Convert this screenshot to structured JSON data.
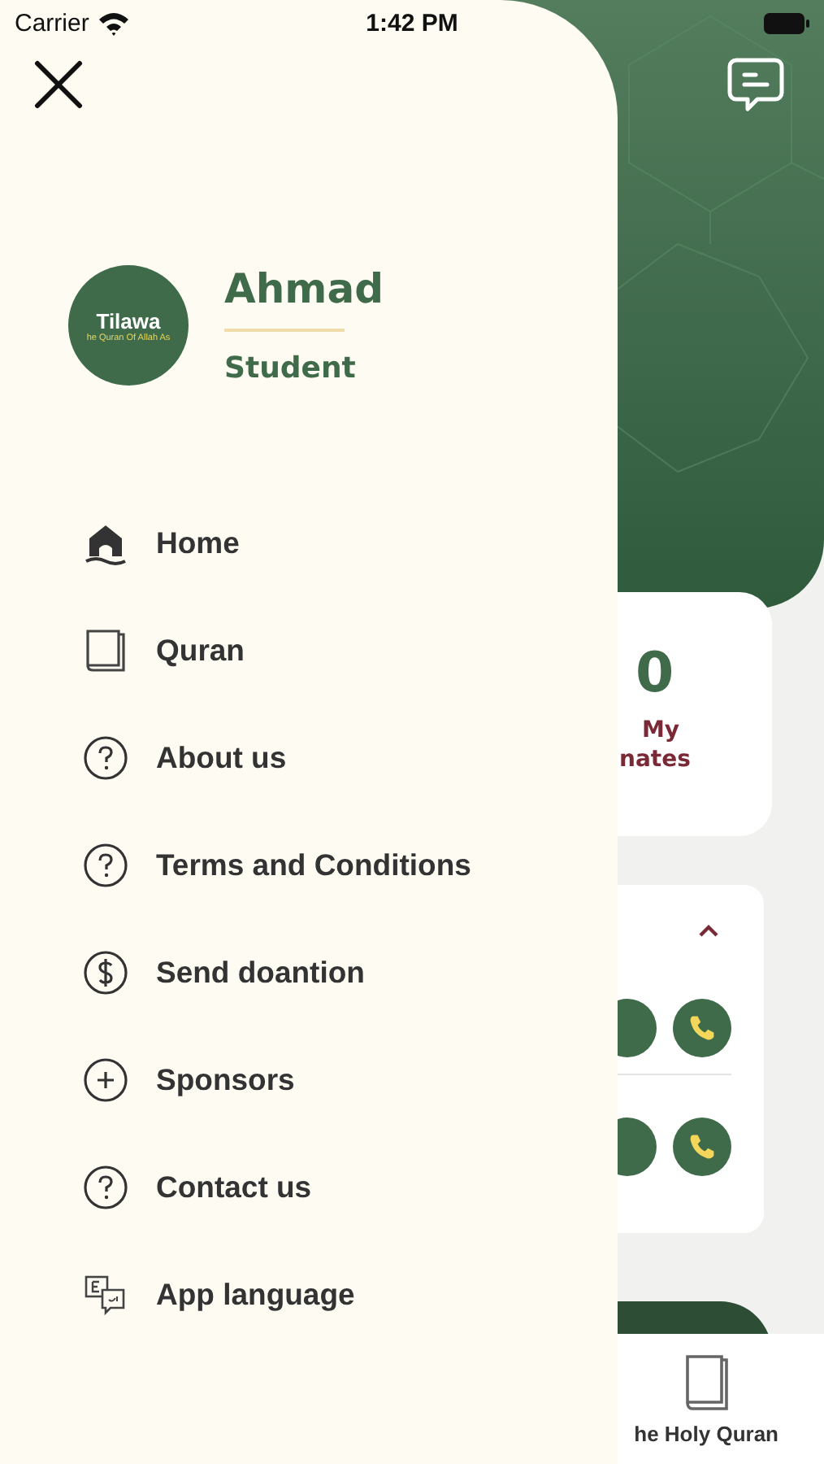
{
  "status_bar": {
    "carrier": "Carrier",
    "time": "1:42 PM"
  },
  "background": {
    "stat_card": {
      "value": "0",
      "label_lines": [
        "My",
        "nates"
      ]
    },
    "contacts_card": {
      "expanded": true
    },
    "tab_bar": {
      "label": "he Holy Quran"
    }
  },
  "drawer": {
    "profile": {
      "logo_title": "Tilawa",
      "logo_subtitle": "he Quran Of Allah As",
      "name": "Ahmad",
      "role": "Student"
    },
    "menu": [
      {
        "label": "Home",
        "kind": "home"
      },
      {
        "label": "Quran",
        "kind": "book"
      },
      {
        "label": "About us",
        "kind": "question"
      },
      {
        "label": "Terms and Conditions",
        "kind": "question"
      },
      {
        "label": "Send doantion",
        "kind": "dollar"
      },
      {
        "label": "Sponsors",
        "kind": "plus"
      },
      {
        "label": "Contact us",
        "kind": "question"
      },
      {
        "label": "App language",
        "kind": "language"
      }
    ]
  }
}
